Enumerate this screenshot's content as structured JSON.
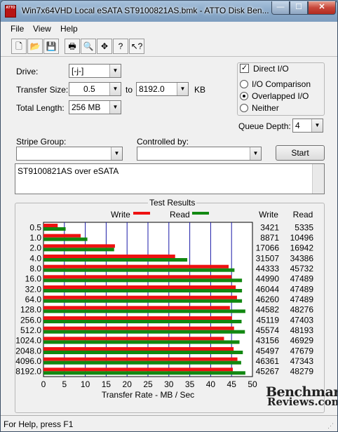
{
  "window": {
    "app_icon_text": "ATTO",
    "title": "Win7x64VHD Local eSATA ST9100821AS.bmk - ATTO Disk Ben...",
    "min_glyph": "—",
    "max_glyph": "☐",
    "close_glyph": "✕"
  },
  "menu": [
    "File",
    "View",
    "Help"
  ],
  "toolbar": [
    {
      "icon": "new-icon",
      "glyph": "🗋"
    },
    {
      "icon": "open-icon",
      "glyph": "📂"
    },
    {
      "icon": "save-icon",
      "glyph": "💾"
    },
    {
      "icon": "print-icon",
      "glyph": "🖶"
    },
    {
      "icon": "print-preview-icon",
      "glyph": "🔍"
    },
    {
      "icon": "move-icon",
      "glyph": "✥"
    },
    {
      "icon": "help-icon",
      "glyph": "?"
    },
    {
      "icon": "context-help-icon",
      "glyph": "↖?"
    }
  ],
  "form": {
    "drive_label": "Drive:",
    "drive_value": "[-j-]",
    "transfer_size_label": "Transfer Size:",
    "transfer_from": "0.5",
    "to_label": "to",
    "transfer_to": "8192.0",
    "kb_label": "KB",
    "total_length_label": "Total Length:",
    "total_length_value": "256 MB",
    "stripe_group_label": "Stripe Group:",
    "stripe_group_value": "",
    "controlled_by_label": "Controlled by:",
    "controlled_by_value": "",
    "start_label": "Start",
    "description": "ST9100821AS over eSATA"
  },
  "options": {
    "direct_io_label": "Direct I/O",
    "direct_io_checked": true,
    "io_comparison_label": "I/O Comparison",
    "overlapped_io_label": "Overlapped I/O",
    "neither_label": "Neither",
    "selected": "Overlapped I/O",
    "queue_depth_label": "Queue Depth:",
    "queue_depth_value": "4"
  },
  "results": {
    "title": "Test Results",
    "write_legend": "Write",
    "read_legend": "Read",
    "write_col": "Write",
    "read_col": "Read",
    "x_axis_label": "Transfer Rate - MB / Sec"
  },
  "colors": {
    "write": "#ee1111",
    "read": "#118811",
    "grid": "#1a1aa8"
  },
  "chart_data": {
    "type": "bar",
    "orientation": "horizontal",
    "categories": [
      "0.5",
      "1.0",
      "2.0",
      "4.0",
      "8.0",
      "16.0",
      "32.0",
      "64.0",
      "128.0",
      "256.0",
      "512.0",
      "1024.0",
      "2048.0",
      "4096.0",
      "8192.0"
    ],
    "series": [
      {
        "name": "Write",
        "values": [
          3.4,
          8.9,
          17.1,
          31.5,
          44.3,
          45.0,
          46.0,
          46.3,
          44.6,
          45.1,
          45.6,
          43.2,
          45.5,
          46.4,
          45.3
        ]
      },
      {
        "name": "Read",
        "values": [
          5.3,
          10.5,
          16.9,
          34.4,
          45.7,
          47.5,
          47.5,
          47.5,
          48.3,
          47.4,
          48.2,
          46.9,
          47.7,
          47.3,
          48.3
        ]
      }
    ],
    "write_values": [
      "3421",
      "8871",
      "17066",
      "31507",
      "44333",
      "44990",
      "46044",
      "46260",
      "44582",
      "45119",
      "45574",
      "43156",
      "45497",
      "46361",
      "45267"
    ],
    "read_values": [
      "5335",
      "10496",
      "16942",
      "34386",
      "45732",
      "47489",
      "47489",
      "47489",
      "48276",
      "47403",
      "48193",
      "46929",
      "47679",
      "47343",
      "48279"
    ],
    "x_ticks": [
      "0",
      "5",
      "10",
      "15",
      "20",
      "25",
      "30",
      "35",
      "40",
      "45",
      "50"
    ],
    "xlim": [
      0,
      50
    ],
    "xlabel": "Transfer Rate - MB / Sec",
    "legend": "top"
  },
  "status": {
    "text": "For Help, press F1",
    "grip": "⋰"
  },
  "watermark": {
    "line1": "Benchmark",
    "line2": "Reviews.com"
  }
}
